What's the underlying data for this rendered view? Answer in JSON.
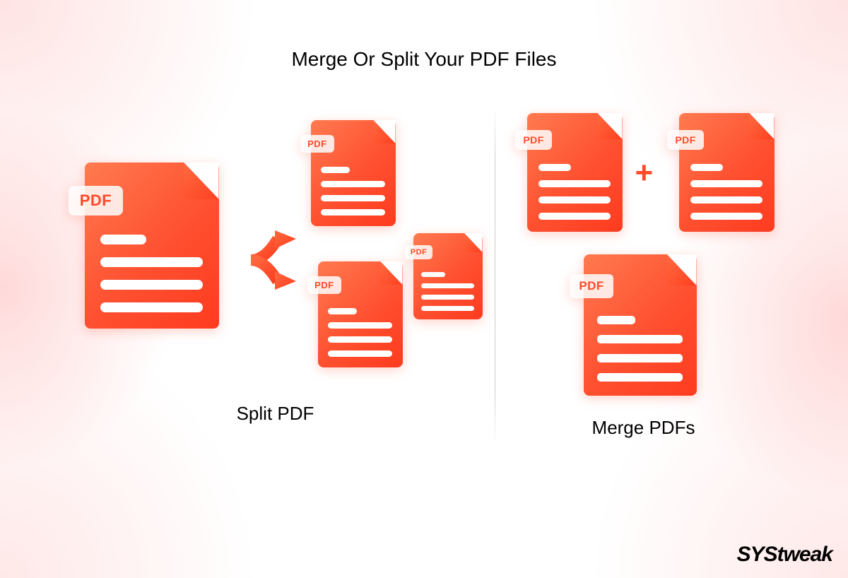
{
  "title": "Merge Or Split Your PDF Files",
  "left": {
    "caption": "Split PDF",
    "badge": "PDF"
  },
  "right": {
    "caption": "Merge PDFs",
    "badge": "PDF",
    "plus": "+"
  },
  "brand": {
    "sys": "SYS",
    "tweak": "Tweak"
  },
  "colors": {
    "accent_start": "#ff7a50",
    "accent_end": "#ff3b1f"
  }
}
